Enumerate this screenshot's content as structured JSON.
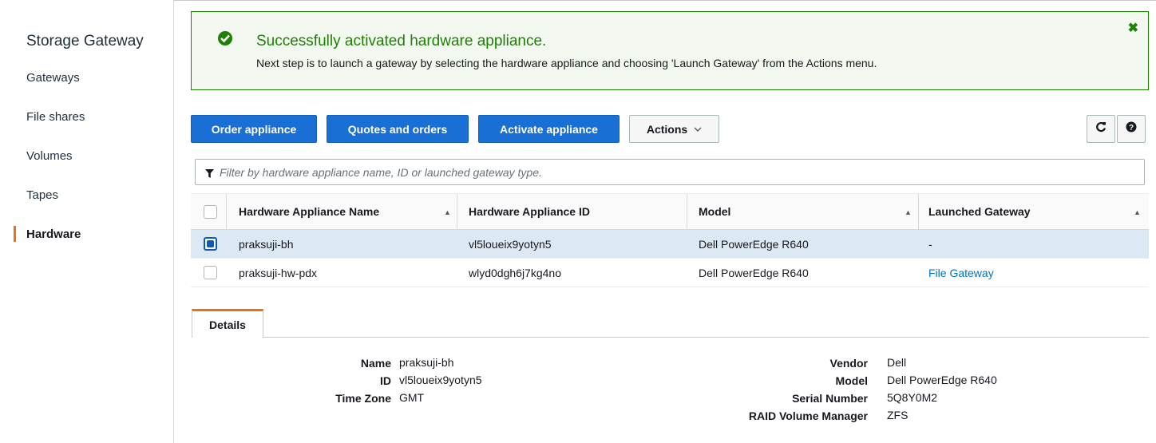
{
  "sidebar": {
    "title": "Storage Gateway",
    "items": [
      {
        "label": "Gateways"
      },
      {
        "label": "File shares"
      },
      {
        "label": "Volumes"
      },
      {
        "label": "Tapes"
      },
      {
        "label": "Hardware",
        "active": true
      }
    ]
  },
  "flash": {
    "title": "Successfully activated hardware appliance.",
    "message": "Next step is to launch a gateway by selecting the hardware appliance and choosing 'Launch Gateway' from the Actions menu.",
    "close_symbol": "✖",
    "color": "#1d8102"
  },
  "toolbar": {
    "order_label": "Order appliance",
    "quotes_label": "Quotes and orders",
    "activate_label": "Activate appliance",
    "actions_label": "Actions",
    "refresh_icon": "refresh-icon",
    "help_icon": "help-icon"
  },
  "filter": {
    "placeholder": "Filter by hardware appliance name, ID or launched gateway type."
  },
  "table": {
    "columns": [
      "Hardware Appliance Name",
      "Hardware Appliance ID",
      "Model",
      "Launched Gateway"
    ],
    "rows": [
      {
        "name": "praksuji-bh",
        "id": "vl5loueix9yotyn5",
        "model": "Dell PowerEdge R640",
        "gateway": "-",
        "selected": true
      },
      {
        "name": "praksuji-hw-pdx",
        "id": "wlyd0dgh6j7kg4no",
        "model": "Dell PowerEdge R640",
        "gateway": "File Gateway",
        "selected": false
      }
    ]
  },
  "details": {
    "tab_label": "Details",
    "left": [
      {
        "label": "Name",
        "value": "praksuji-bh"
      },
      {
        "label": "ID",
        "value": "vl5loueix9yotyn5"
      },
      {
        "label": "Time Zone",
        "value": "GMT"
      }
    ],
    "right": [
      {
        "label": "Vendor",
        "value": "Dell"
      },
      {
        "label": "Model",
        "value": "Dell PowerEdge R640"
      },
      {
        "label": "Serial Number",
        "value": "5Q8Y0M2"
      },
      {
        "label": "RAID Volume Manager",
        "value": "ZFS"
      }
    ]
  },
  "colors": {
    "primary_button": "#1a6fd4",
    "accent": "#ec7211",
    "link": "#0073bb",
    "selected_row": "#dce8f4"
  }
}
